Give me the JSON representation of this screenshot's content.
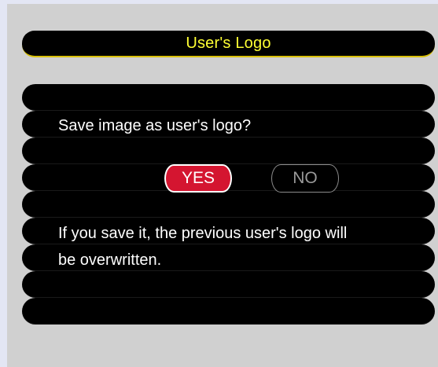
{
  "dialog": {
    "title": "User's Logo",
    "question": "Save image as user's logo?",
    "yes_label": "YES",
    "no_label": "NO",
    "warning_line1": "If you save it, the previous user's logo will",
    "warning_line2": "be overwritten."
  },
  "colors": {
    "title_text": "#ffff33",
    "title_underline": "#d8c000",
    "yes_button": "#d41530",
    "panel_background": "#d0d0d0",
    "row_background": "#000000"
  }
}
